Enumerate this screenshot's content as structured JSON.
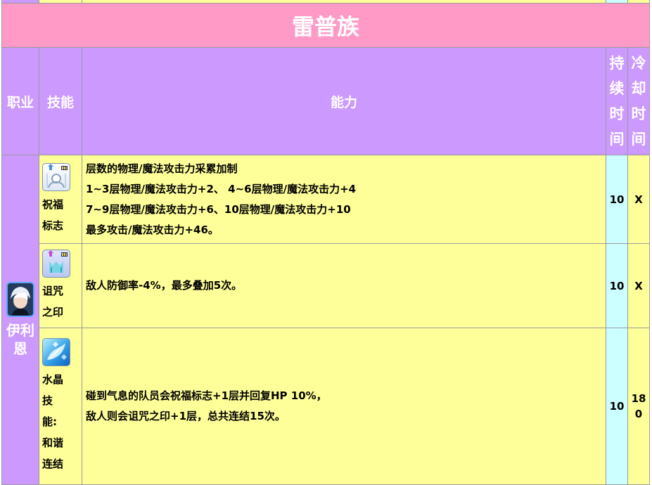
{
  "race_title": "雷普族",
  "headers": {
    "job": "职业",
    "skill": "技能",
    "ability": "能力",
    "duration": [
      "持",
      "续",
      "时",
      "间"
    ],
    "cooldown": [
      "冷",
      "却",
      "时",
      "间"
    ]
  },
  "job": {
    "name_chars": [
      "伊利",
      "恩"
    ],
    "avatar_icon": "character-avatar-icon"
  },
  "rows": [
    {
      "icon": "blessing-mark-icon",
      "skill_lines": [
        "祝福",
        "标志"
      ],
      "ability_lines": [
        "层数的物理/魔法攻击力采累加制",
        "1~3层物理/魔法攻击力+2、 4~6层物理/魔法攻击力+4",
        "7~9层物理/魔法攻击力+6、10层物理/魔法攻击力+10",
        "最多攻击/魔法攻击力+46。"
      ],
      "duration": "10",
      "cooldown": [
        "X"
      ]
    },
    {
      "icon": "curse-seal-icon",
      "skill_lines": [
        "诅咒",
        "之印"
      ],
      "ability_lines": [
        "敌人防御率-4%，最多叠加5次。"
      ],
      "duration": "10",
      "cooldown": [
        "X"
      ]
    },
    {
      "icon": "crystal-skill-icon",
      "skill_lines": [
        "水晶",
        "技",
        "能:",
        "和谐",
        "连结"
      ],
      "ability_lines": [
        "碰到气息的队员会祝福标志+1层并回复HP 10%，",
        "敌人则会诅咒之印+1层，总共连结15次。"
      ],
      "duration": "10",
      "cooldown": [
        "18",
        "0"
      ]
    }
  ],
  "colors": {
    "race_header": "#ff99c6",
    "column_header": "#cc99ff",
    "cell_yellow": "#ffff99",
    "cell_cyan": "#ccffff"
  }
}
